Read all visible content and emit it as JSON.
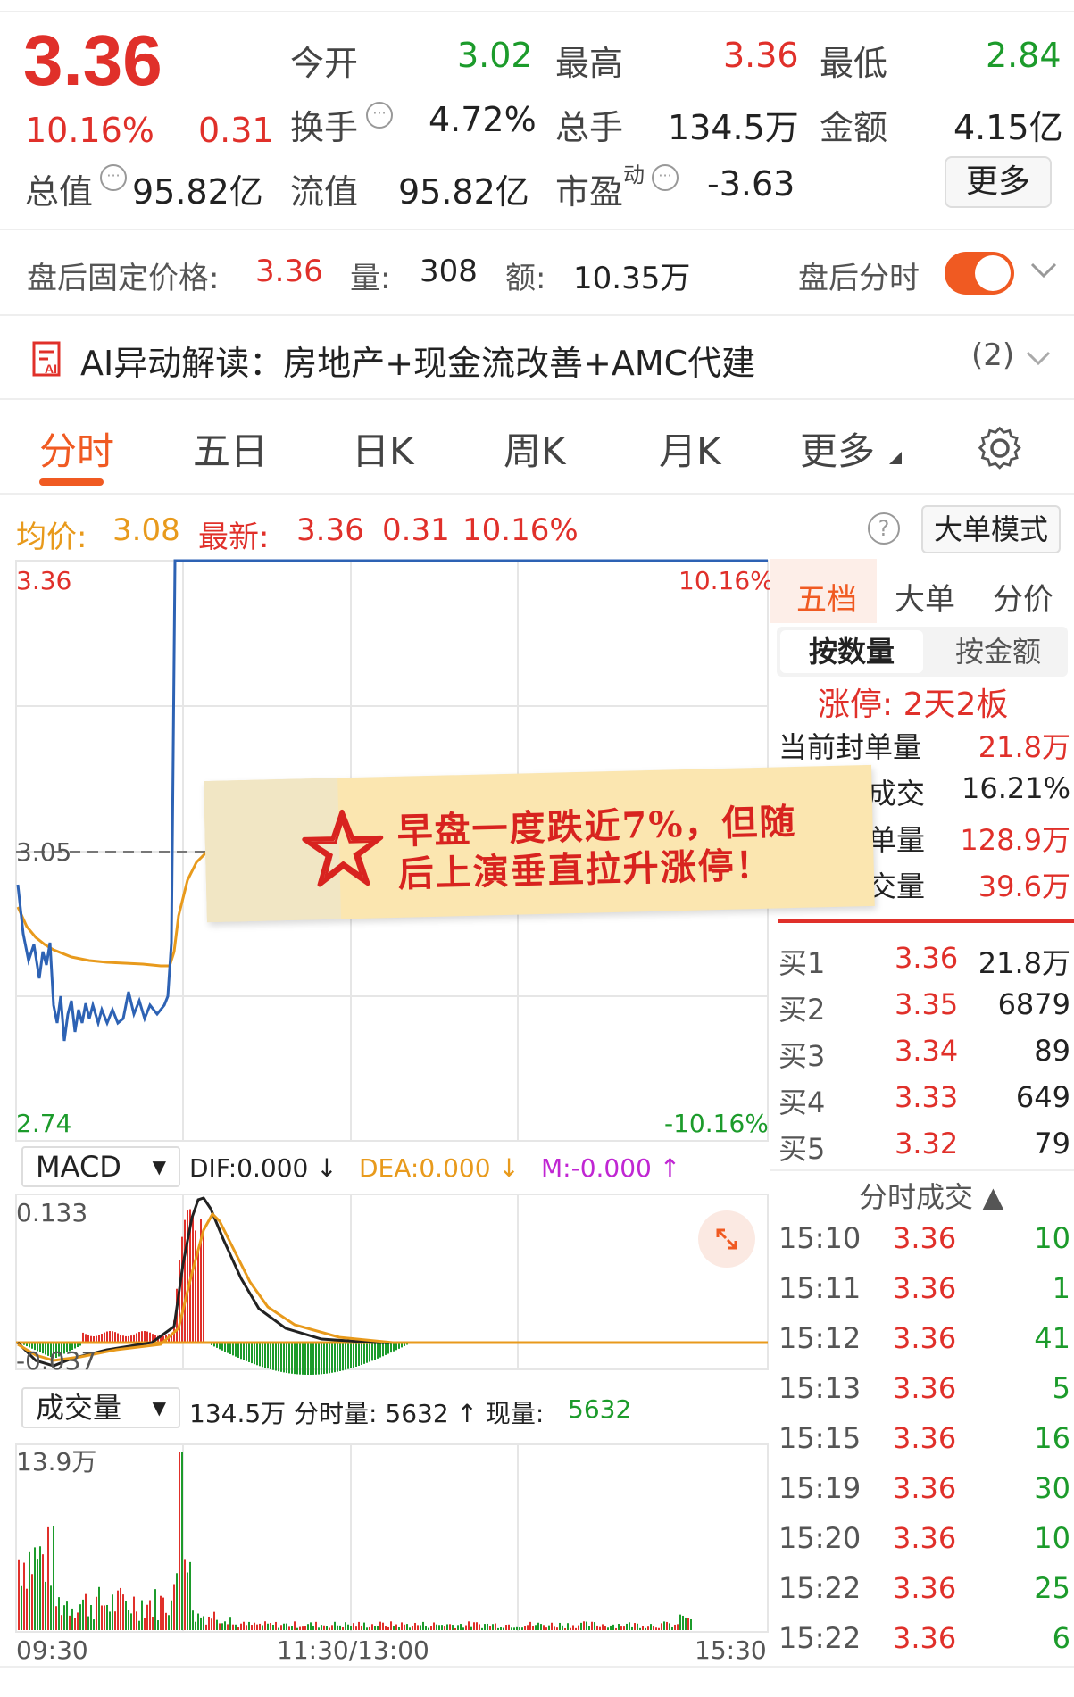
{
  "quote": {
    "price": "3.36",
    "change_pct": "10.16%",
    "change": "0.31",
    "open_label": "今开",
    "open_value": "3.02",
    "high_label": "最高",
    "high_value": "3.36",
    "low_label": "最低",
    "low_value": "2.84",
    "turnover_label": "换手",
    "turnover_value": "4.72%",
    "volume_label": "总手",
    "volume_value": "134.5万",
    "amount_label": "金额",
    "amount_value": "4.15亿",
    "mktcap_label": "总值",
    "mktcap_value": "95.82亿",
    "float_label": "流值",
    "float_value": "95.82亿",
    "pe_label": "市盈",
    "pe_sup": "动",
    "pe_value": "-3.63",
    "more_label": "更多"
  },
  "after_hours": {
    "price_label": "盘后固定价格:",
    "price_value": "3.36",
    "vol_label": "量:",
    "vol_value": "308",
    "amt_label": "额:",
    "amt_value": "10.35万",
    "timeshare_label": "盘后分时"
  },
  "ai": {
    "text": "AI异动解读：房地产+现金流改善+AMC代建",
    "count": "(2)"
  },
  "tabs": [
    "分时",
    "五日",
    "日K",
    "周K",
    "月K",
    "更多"
  ],
  "price_line": {
    "avg_label": "均价:",
    "avg_value": "3.08",
    "latest_label": "最新:",
    "latest_value": "3.36",
    "latest_change": "0.31",
    "latest_pct": "10.16%",
    "mode_button": "大单模式"
  },
  "chart_labels": {
    "top_price": "3.36",
    "top_pct": "10.16%",
    "mid_price": "3.05",
    "bottom_price": "2.74",
    "bottom_pct": "-10.16%",
    "macd_selector": "MACD",
    "dif": "DIF:0.000 ↓",
    "dea": "DEA:0.000 ↓",
    "m": "M:-0.000 ↑",
    "macd_top": "0.133",
    "macd_bottom": "-0.037",
    "vol_selector": "成交量",
    "vol_info": "134.5万 分时量: 5632 ↑ 现量: ",
    "vol_now": "5632",
    "vol_top": "13.9万",
    "time_start": "09:30",
    "time_mid": "11:30/13:00",
    "time_end": "15:30"
  },
  "sticker": {
    "line1": "早盘一度跌近7%，但随",
    "line2": "后上演垂直拉升涨停！"
  },
  "right_panel": {
    "tabs": [
      "五档",
      "大单",
      "分价"
    ],
    "subtabs": [
      "按数量",
      "按金额"
    ],
    "limit_text": "涨停: 2天2板",
    "stats": [
      {
        "label": "当前封单量",
        "value": "21.8万"
      },
      {
        "label": "成交",
        "value": "16.21%"
      },
      {
        "label": "单量",
        "value": "128.9万"
      },
      {
        "label": "交量",
        "value": "39.6万"
      }
    ],
    "bids": [
      {
        "label": "买1",
        "price": "3.36",
        "vol": "21.8万"
      },
      {
        "label": "买2",
        "price": "3.35",
        "vol": "6879"
      },
      {
        "label": "买3",
        "price": "3.34",
        "vol": "89"
      },
      {
        "label": "买4",
        "price": "3.33",
        "vol": "649"
      },
      {
        "label": "买5",
        "price": "3.32",
        "vol": "79"
      }
    ],
    "ticks_header": "分时成交 ▲",
    "ticks": [
      {
        "time": "15:10",
        "price": "3.36",
        "vol": "10"
      },
      {
        "time": "15:11",
        "price": "3.36",
        "vol": "1"
      },
      {
        "time": "15:12",
        "price": "3.36",
        "vol": "41"
      },
      {
        "time": "15:13",
        "price": "3.36",
        "vol": "5"
      },
      {
        "time": "15:15",
        "price": "3.36",
        "vol": "16"
      },
      {
        "time": "15:19",
        "price": "3.36",
        "vol": "30"
      },
      {
        "time": "15:20",
        "price": "3.36",
        "vol": "10"
      },
      {
        "time": "15:22",
        "price": "3.36",
        "vol": "25"
      },
      {
        "time": "15:22",
        "price": "3.36",
        "vol": "6"
      }
    ]
  },
  "colors": {
    "up": "#e0302a",
    "down": "#1c9b2b",
    "avg": "#e89a1c",
    "accent": "#f05a22",
    "price_line": "#2d62b4"
  }
}
